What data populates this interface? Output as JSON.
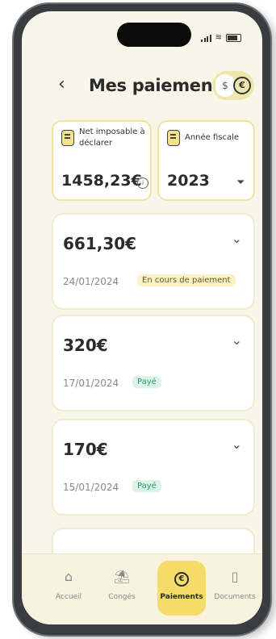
{
  "header": {
    "title": "Mes paiements",
    "back_icon": "back-arrow-icon",
    "currency_toggle": {
      "off_symbol": "$",
      "on_symbol": "€"
    }
  },
  "summary": {
    "net_label": "Net imposable à déclarer",
    "net_value": "1458,23€",
    "year_label": "Année fiscale",
    "year_value": "2023"
  },
  "payments": [
    {
      "amount": "661,30€",
      "date": "24/01/2024",
      "status": "En cours de paiement"
    },
    {
      "amount": "320€",
      "date": "17/01/2024",
      "status": "Payé"
    },
    {
      "amount": "170€",
      "date": "15/01/2024",
      "status": "Payé"
    }
  ],
  "nav": {
    "items": [
      {
        "label": "Accueil",
        "icon": "home-icon"
      },
      {
        "label": "Congés",
        "icon": "beach-icon"
      },
      {
        "label": "Paiements",
        "icon": "euro-icon",
        "active": true
      },
      {
        "label": "Documents",
        "icon": "document-icon"
      }
    ]
  },
  "colors": {
    "accent": "#f5dc6a",
    "paid": "#2e9a63",
    "pending_bg": "#faf1c8",
    "background": "#f8f6e8"
  }
}
